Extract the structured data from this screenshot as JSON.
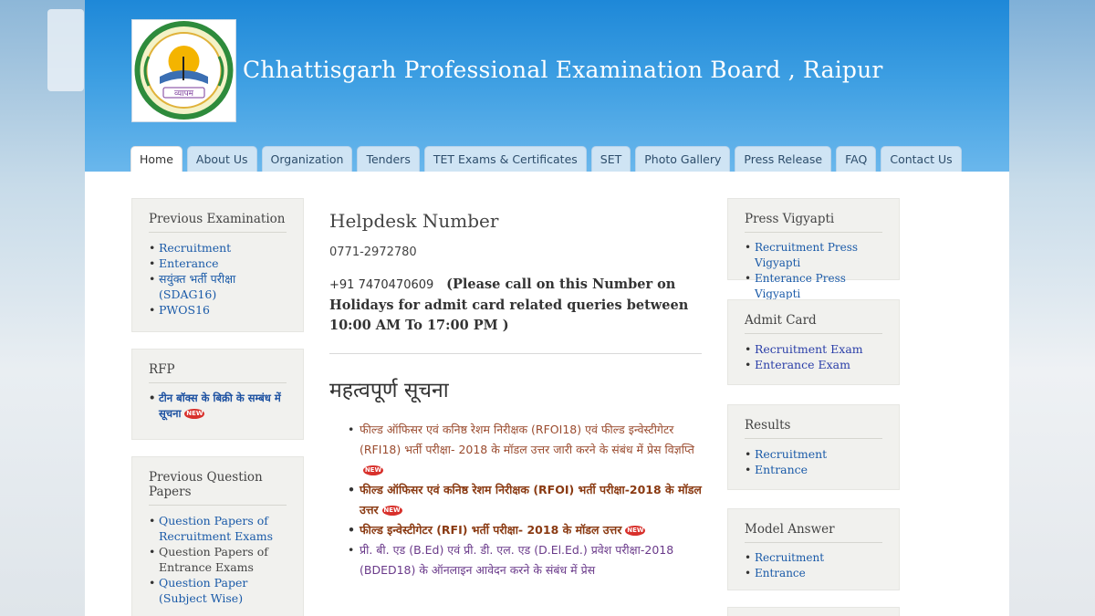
{
  "header": {
    "title": "Chhattisgarh Professional Examination Board , Raipur",
    "logo_text": "व्यापम"
  },
  "nav": {
    "tabs": [
      {
        "label": "Home",
        "active": true
      },
      {
        "label": "About Us"
      },
      {
        "label": "Organization"
      },
      {
        "label": "Tenders"
      },
      {
        "label": "TET Exams & Certificates"
      },
      {
        "label": "SET"
      },
      {
        "label": "Photo Gallery"
      },
      {
        "label": "Press Release"
      },
      {
        "label": "FAQ"
      },
      {
        "label": "Contact Us"
      }
    ]
  },
  "left_sidebar": {
    "previous_examination": {
      "title": "Previous Examination",
      "items": [
        "Recruitment",
        "Enterance",
        "सयुंक्त भर्ती परीक्षा (SDAG16)",
        "PWOS16"
      ]
    },
    "rfp": {
      "title": "RFP",
      "items": [
        "टीन बॉक्स के बिक्री के सम्बंध में सूचना"
      ]
    },
    "previous_question_papers": {
      "title": "Previous Question Papers",
      "items": [
        "Question Papers of Recruitment Exams",
        "Question Papers of Entrance Exams",
        "Question Paper (Subject Wise)"
      ]
    }
  },
  "main": {
    "helpdesk_title": "Helpdesk Number",
    "phone1": "0771-2972780",
    "phone2": "+91 7470470609",
    "helpline_note": "(Please call on this Number on Holidays for admit card related queries between 10:00 AM To 17:00 PM )",
    "notice_heading": "महत्वपूर्ण सूचना",
    "notices": [
      "फील्ड ऑफिसर एवं कनिष्ठ रेशम निरीक्षक (RFOI18) एवं फील्ड इन्वेस्टीगेटर (RFI18) भर्ती परीक्षा- 2018 के मॉडल उत्तर जारी करने के संबंध में प्रेस विज्ञप्ति",
      "फील्ड ऑफिसर एवं कनिष्ठ रेशम निरीक्षक (RFOI) भर्ती परीक्षा-2018 के मॉडल उत्तर",
      "फील्ड इन्वेस्टीगेटर (RFI) भर्ती परीक्षा- 2018 के मॉडल उत्तर",
      "प्री. बी. एड (B.Ed) एवं प्री. डी. एल. एड (D.El.Ed.) प्रवेश परीक्षा-2018 (BDED18) के ऑनलाइन आवेदन करने के संबंध में प्रेस"
    ],
    "new_badge": "NEW"
  },
  "right_sidebar": {
    "press_vigyapti": {
      "title": "Press Vigyapti",
      "items": [
        "Recruitment Press Vigyapti",
        "Enterance Press Vigyapti"
      ]
    },
    "admit_card": {
      "title": "Admit Card",
      "items": [
        "Recruitment Exam",
        "Enterance Exam"
      ]
    },
    "results": {
      "title": "Results",
      "items": [
        "Recruitment",
        "Entrance"
      ]
    },
    "model_answer": {
      "title": "Model Answer",
      "items": [
        "Recruitment",
        "Entrance"
      ]
    }
  },
  "colors": {
    "header_blue": "#2a8fdb",
    "link_blue": "#1a5aa8",
    "notice_brown": "#8a3a12",
    "badge_red": "#d8312c"
  }
}
